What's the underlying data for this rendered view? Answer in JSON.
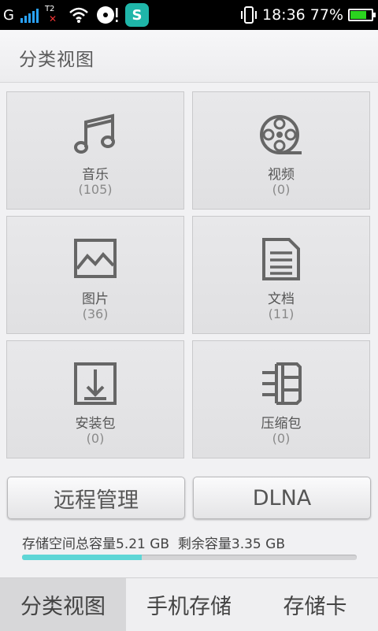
{
  "status_bar": {
    "time": "18:36",
    "battery_percent_text": "77%",
    "battery_level": 0.77,
    "sim1_label": "G",
    "sim2_label": "T2",
    "shield_letter": "S",
    "icons": [
      "signal-icon",
      "wifi-icon",
      "cd-icon",
      "shield-app-icon",
      "vibrate-icon",
      "battery-icon"
    ]
  },
  "header": {
    "title": "分类视图"
  },
  "categories": [
    {
      "label": "音乐",
      "count": "(105)",
      "icon": "music-note-icon"
    },
    {
      "label": "视频",
      "count": "(0)",
      "icon": "film-reel-icon"
    },
    {
      "label": "图片",
      "count": "(36)",
      "icon": "picture-icon"
    },
    {
      "label": "文档",
      "count": "(11)",
      "icon": "document-icon"
    },
    {
      "label": "安装包",
      "count": "(0)",
      "icon": "download-package-icon"
    },
    {
      "label": "压缩包",
      "count": "(0)",
      "icon": "archive-icon"
    }
  ],
  "actions": {
    "remote_label": "远程管理",
    "dlna_label": "DLNA"
  },
  "storage": {
    "text": "存储空间总容量5.21 GB  剩余容量3.35 GB",
    "used_fraction": 0.357
  },
  "tabs": [
    {
      "label": "分类视图",
      "active": true
    },
    {
      "label": "手机存储",
      "active": false
    },
    {
      "label": "存储卡",
      "active": false
    }
  ],
  "colors": {
    "accent_progress": "#5ed6d6",
    "battery_green": "#2bd41f",
    "signal_blue": "#2aa3ff"
  }
}
